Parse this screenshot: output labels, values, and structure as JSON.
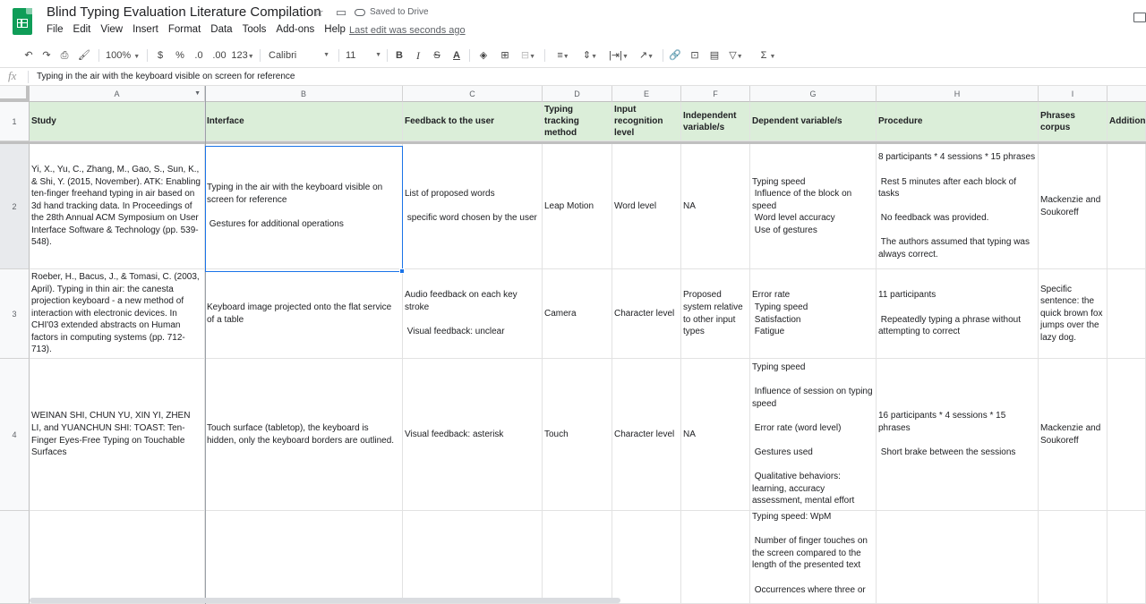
{
  "header": {
    "title": "Blind Typing Evaluation Literature Compilation",
    "saved_status": "Saved to Drive",
    "last_edit": "Last edit was seconds ago",
    "menu": [
      "File",
      "Edit",
      "View",
      "Insert",
      "Format",
      "Data",
      "Tools",
      "Add-ons",
      "Help"
    ]
  },
  "toolbar": {
    "zoom": "100%",
    "currency": "$",
    "percent": "%",
    "dec_decrease": ".0",
    "dec_increase": ".00",
    "number_format": "123",
    "font": "Calibri",
    "font_size": "11",
    "bold": "B",
    "italic": "I",
    "strike": "S",
    "text_color": "A",
    "sum": "Σ"
  },
  "formula_bar": {
    "fx": "fx",
    "value": "Typing in the air with the keyboard visible on screen for reference"
  },
  "columns": [
    "A",
    "B",
    "C",
    "D",
    "E",
    "F",
    "G",
    "H",
    "I"
  ],
  "rows": [
    {
      "num": "1",
      "cells": [
        "Study",
        "Interface",
        "Feedback to the user",
        "Typing tracking method",
        "Input recognition level",
        "Independent variable/s",
        "Dependent variable/s",
        "Procedure",
        "Phrases corpus",
        "Additional"
      ]
    },
    {
      "num": "2",
      "cells": [
        "Yi, X., Yu, C., Zhang, M., Gao, S., Sun, K., & Shi, Y. (2015, November). ATK: Enabling ten-finger freehand typing in air based on 3d hand tracking data. In Proceedings of the 28th Annual ACM Symposium on User Interface Software & Technology (pp. 539-548).",
        "Typing in the air with the keyboard visible on screen for reference\n\n Gestures for additional operations",
        "List of proposed words\n\n specific word chosen by the user",
        "Leap Motion",
        "Word level",
        "NA",
        "Typing speed\n Influence of the block on speed\n Word level accuracy\n Use of gestures",
        "8 participants * 4 sessions * 15 phrases\n\n Rest 5 minutes after each block of tasks\n\n No feedback was provided.\n\n The authors assumed that typing was always correct.",
        "Mackenzie and Soukoreff",
        ""
      ]
    },
    {
      "num": "3",
      "cells": [
        "Roeber, H., Bacus, J., & Tomasi, C. (2003, April). Typing in thin air: the canesta projection keyboard - a new method of interaction with electronic devices. In CHI'03 extended abstracts on Human factors in computing systems (pp. 712-713).",
        "Keyboard image projected onto the flat service of a table",
        "Audio feedback on each key stroke\n\n Visual feedback: unclear",
        "Camera",
        "Character level",
        "Proposed system relative to other input types",
        "Error rate\n Typing speed\n Satisfaction\n Fatigue",
        "11 participants\n\n Repeatedly typing a phrase without attempting to correct",
        "Specific sentence: the quick brown fox jumps over the lazy dog.",
        ""
      ]
    },
    {
      "num": "4",
      "cells": [
        "WEINAN SHI, CHUN YU, XIN YI, ZHEN LI, and YUANCHUN SHI: TOAST: Ten-Finger Eyes-Free Typing on Touchable Surfaces",
        "Touch surface (tabletop), the keyboard is hidden, only the keyboard borders are outlined.",
        "Visual feedback: asterisk",
        "Touch",
        "Character level",
        "NA",
        "Typing speed\n\n Influence of session on typing speed\n\n Error rate (word level)\n\n Gestures used\n\n Qualitative behaviors: learning, accuracy assessment, mental effort",
        "16 participants * 4 sessions * 15 phrases\n\n Short brake between the sessions",
        "Mackenzie and Soukoreff",
        ""
      ]
    },
    {
      "num": "5",
      "cells": [
        "",
        "",
        "",
        "",
        "",
        "",
        "Typing speed: WpM\n\n Number of finger touches on the screen compared to the length of the presented text\n\n Occurrences where three or",
        "",
        "",
        ""
      ]
    }
  ]
}
